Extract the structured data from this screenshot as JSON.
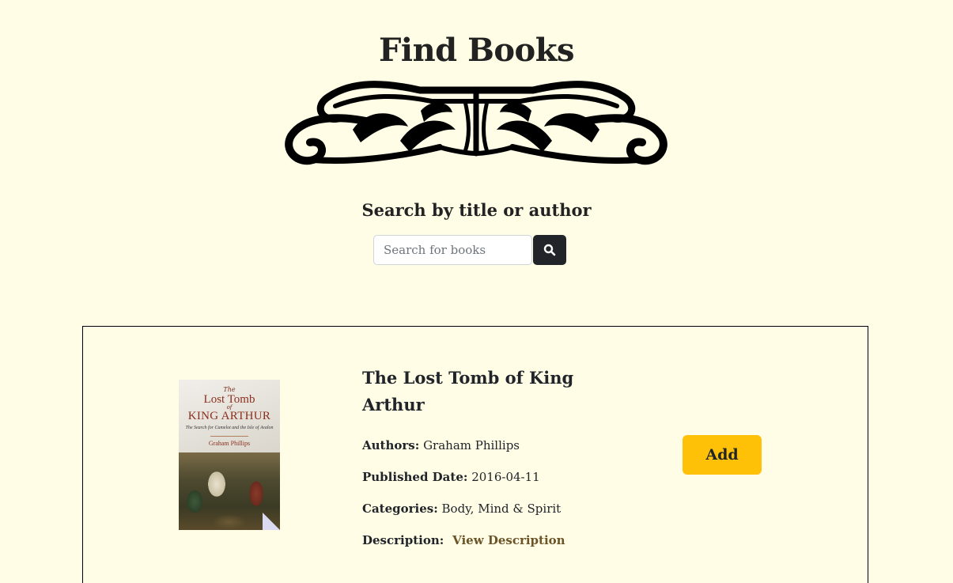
{
  "header": {
    "title": "Find Books",
    "ornament_icon": "flourish-divider-icon"
  },
  "search": {
    "heading": "Search by title or author",
    "placeholder": "Search for books",
    "value": "",
    "button_icon": "search-icon"
  },
  "results": [
    {
      "title": "The Lost Tomb of King Arthur",
      "authors_label": "Authors:",
      "authors": "Graham Phillips",
      "published_label": "Published Date:",
      "published_date": "2016-04-11",
      "categories_label": "Categories:",
      "categories": "Body, Mind & Spirit",
      "description_label": "Description:",
      "description_link": "View Description",
      "add_label": "Add",
      "cover": {
        "line1": "The",
        "line2": "Lost Tomb",
        "line3": "of",
        "line4": "KING ARTHUR",
        "subtitle": "The Search for Camelot and the Isle of Avalon",
        "author": "Graham Phillips"
      }
    }
  ],
  "colors": {
    "background": "#fffde5",
    "button_dark": "#212529",
    "add_button": "#ffc107",
    "link": "#6b5428"
  }
}
